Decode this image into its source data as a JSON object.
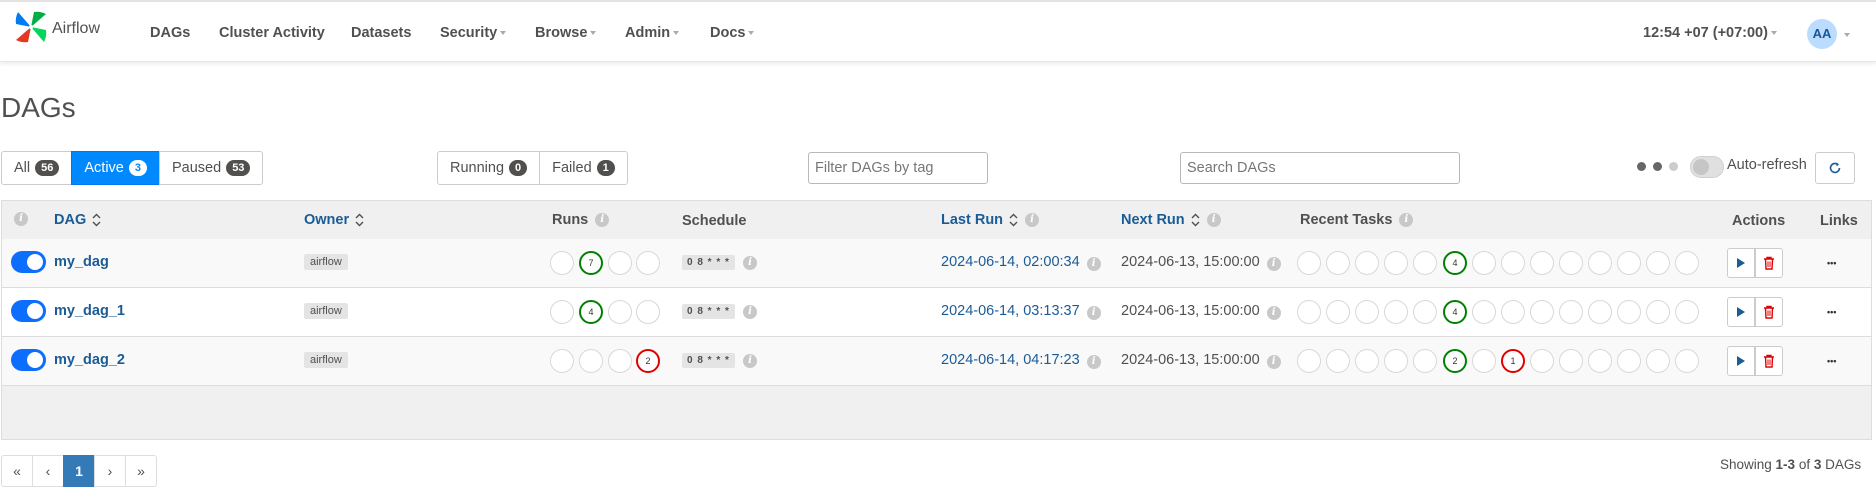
{
  "nav": {
    "brand": "Airflow",
    "items": [
      "DAGs",
      "Cluster Activity",
      "Datasets",
      "Security",
      "Browse",
      "Admin",
      "Docs"
    ],
    "clock": "12:54 +07 (+07:00)",
    "user_initials": "AA"
  },
  "page_title": "DAGs",
  "status_filters": [
    {
      "label": "All",
      "count": "56"
    },
    {
      "label": "Active",
      "count": "3"
    },
    {
      "label": "Paused",
      "count": "53"
    }
  ],
  "run_filters": [
    {
      "label": "Running",
      "count": "0"
    },
    {
      "label": "Failed",
      "count": "1"
    }
  ],
  "tag_filter_placeholder": "Filter DAGs by tag",
  "search_placeholder": "Search DAGs",
  "auto_refresh_label": "Auto-refresh",
  "columns": {
    "dag": "DAG",
    "owner": "Owner",
    "runs": "Runs",
    "schedule": "Schedule",
    "last_run": "Last Run",
    "next_run": "Next Run",
    "recent_tasks": "Recent Tasks",
    "actions": "Actions",
    "links": "Links"
  },
  "dags": [
    {
      "name": "my_dag",
      "owner": "airflow",
      "schedule": "0 8 * * *",
      "last_run": "2024-06-14, 02:00:34",
      "next_run": "2024-06-13, 15:00:00",
      "runs": [
        "",
        "7",
        "",
        ""
      ],
      "runs_status": [
        "",
        "green",
        "",
        ""
      ],
      "tasks": [
        "",
        "",
        "",
        "",
        "",
        "4",
        "",
        "",
        "",
        "",
        "",
        "",
        "",
        ""
      ],
      "tasks_status": [
        "",
        "",
        "",
        "",
        "",
        "green",
        "",
        "",
        "",
        "",
        "",
        "",
        "",
        ""
      ]
    },
    {
      "name": "my_dag_1",
      "owner": "airflow",
      "schedule": "0 8 * * *",
      "last_run": "2024-06-14, 03:13:37",
      "next_run": "2024-06-13, 15:00:00",
      "runs": [
        "",
        "4",
        "",
        ""
      ],
      "runs_status": [
        "",
        "green",
        "",
        ""
      ],
      "tasks": [
        "",
        "",
        "",
        "",
        "",
        "4",
        "",
        "",
        "",
        "",
        "",
        "",
        "",
        ""
      ],
      "tasks_status": [
        "",
        "",
        "",
        "",
        "",
        "green",
        "",
        "",
        "",
        "",
        "",
        "",
        "",
        ""
      ]
    },
    {
      "name": "my_dag_2",
      "owner": "airflow",
      "schedule": "0 8 * * *",
      "last_run": "2024-06-14, 04:17:23",
      "next_run": "2024-06-13, 15:00:00",
      "runs": [
        "",
        "",
        "",
        "2"
      ],
      "runs_status": [
        "",
        "",
        "",
        "red"
      ],
      "tasks": [
        "",
        "",
        "",
        "",
        "",
        "2",
        "",
        "1",
        "",
        "",
        "",
        "",
        "",
        ""
      ],
      "tasks_status": [
        "",
        "",
        "",
        "",
        "",
        "green",
        "",
        "red",
        "",
        "",
        "",
        "",
        "",
        ""
      ]
    }
  ],
  "pagination": {
    "first": "«",
    "prev": "‹",
    "current": "1",
    "next": "›",
    "last": "»"
  },
  "showing": {
    "prefix": "Showing ",
    "range": "1-3",
    "of": " of ",
    "total": "3",
    "suffix": " DAGs"
  },
  "colors": {
    "accent": "#0088ff",
    "success": "#008000",
    "failed": "#e00000",
    "link": "#1b5c96"
  }
}
